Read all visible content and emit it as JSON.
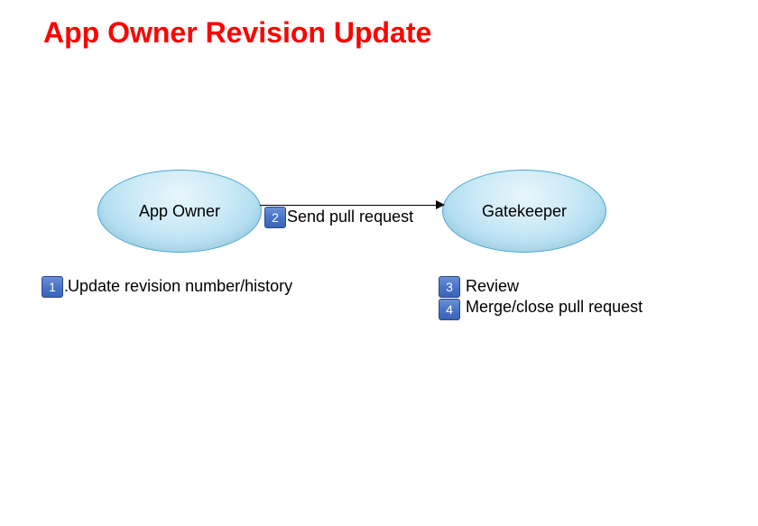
{
  "title": "App Owner Revision Update",
  "nodes": {
    "app_owner": "App Owner",
    "gatekeeper": "Gatekeeper"
  },
  "edge_label": "Send pull request",
  "steps": {
    "s1": {
      "num": "1",
      "text": "Update revision number/history"
    },
    "s2": {
      "num": "2",
      "text": "Send pull request"
    },
    "s3": {
      "num": "3",
      "text": "Review"
    },
    "s4": {
      "num": "4",
      "text": "Merge/close pull request"
    }
  },
  "colors": {
    "title": "#ff0000",
    "badge_bg": "#4a74c7",
    "ellipse_fill": "#a7d9ef",
    "ellipse_stroke": "#4aa7cf"
  }
}
